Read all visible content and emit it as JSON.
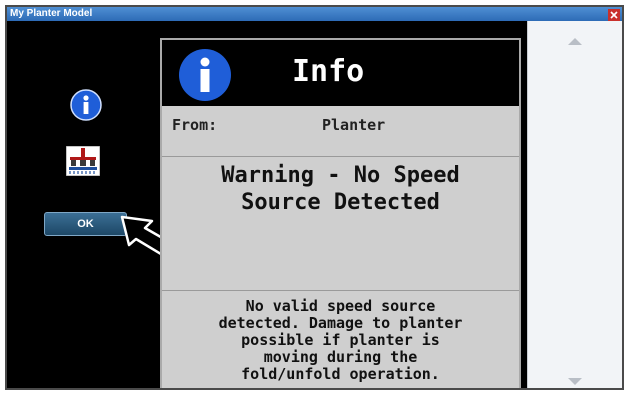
{
  "window": {
    "title": "My Planter Model"
  },
  "left_panel": {
    "ok_label": "OK"
  },
  "dialog": {
    "header_title": "Info",
    "from_label": "From:",
    "from_value": "Planter",
    "warning_lines": [
      "Warning - No Speed",
      "Source Detected"
    ],
    "message_lines": [
      "No valid speed source",
      "detected. Damage to planter",
      "possible if planter is",
      "moving during the",
      "fold/unfold operation."
    ]
  },
  "colors": {
    "titlebar": "#2d6bb6",
    "info_icon_blue": "#1f5ed8",
    "ok_button": "#2a5a7e",
    "dialog_bg": "#cfcfcf"
  },
  "icons": [
    "close-icon",
    "info-icon",
    "planter-icon",
    "pointer-arrow",
    "scroll-up-icon",
    "scroll-down-icon"
  ]
}
